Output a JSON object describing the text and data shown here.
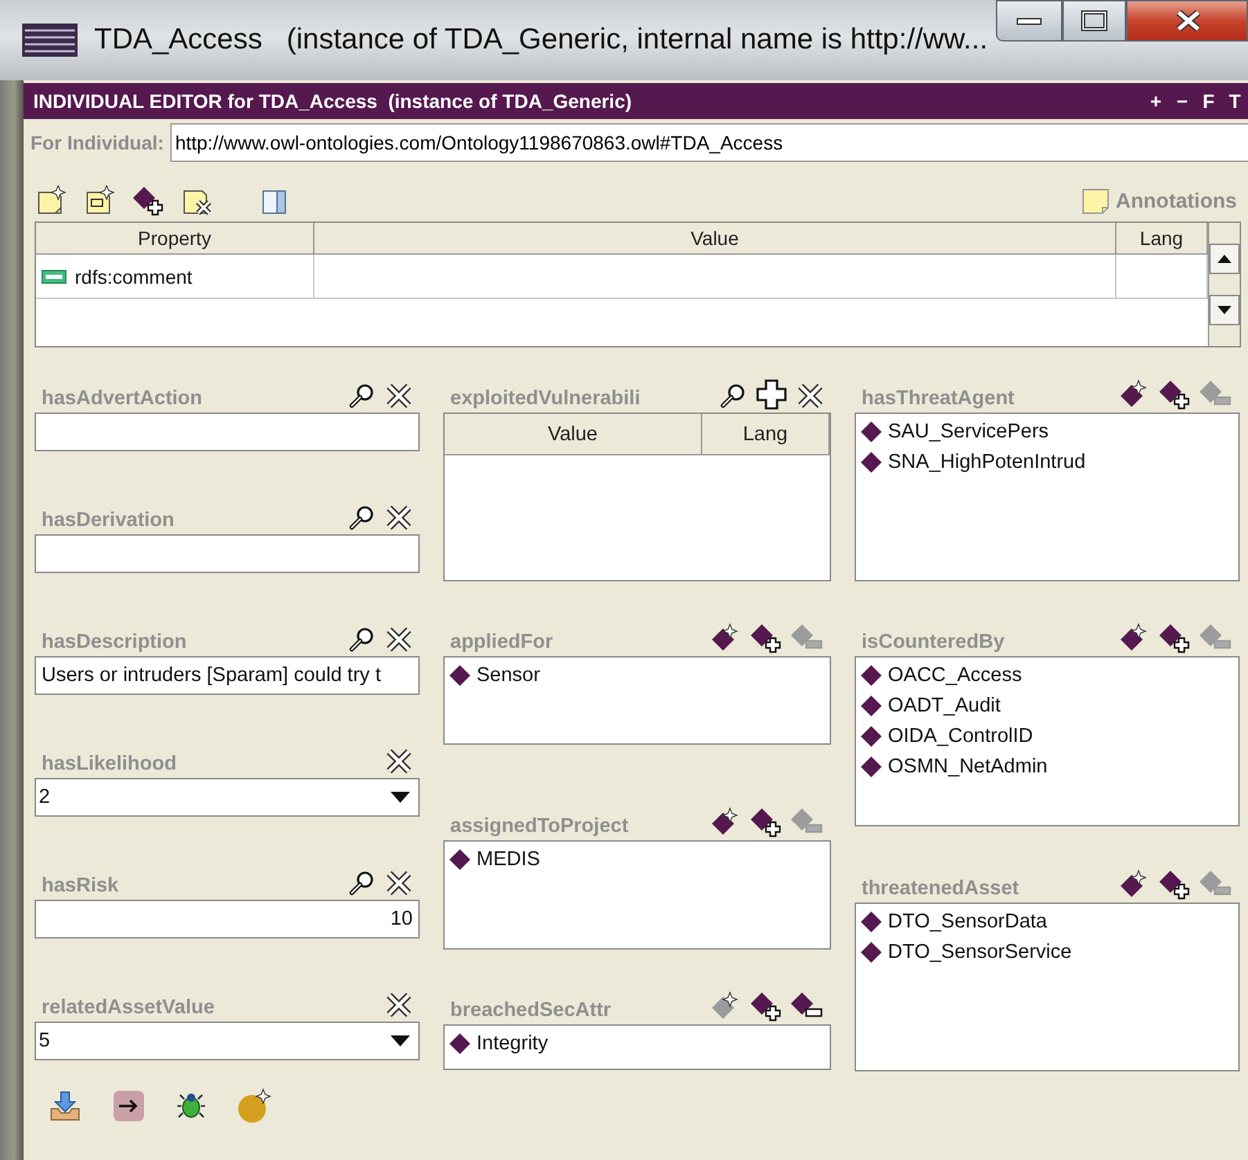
{
  "window": {
    "title": "TDA_Access   (instance of TDA_Generic, internal name is http://ww..."
  },
  "editor": {
    "title": "INDIVIDUAL EDITOR for TDA_Access  (instance of TDA_Generic)",
    "header_buttons": [
      "+",
      "−",
      "F",
      "T"
    ]
  },
  "individual": {
    "label": "For Individual:",
    "value": "http://www.owl-ontologies.com/Ontology1198670863.owl#TDA_Access"
  },
  "toolbar": {
    "buttons": [
      {
        "kind": "create-note"
      },
      {
        "kind": "create-doc-note"
      },
      {
        "kind": "add-instance"
      },
      {
        "kind": "delete-note"
      },
      {
        "kind": "panel"
      }
    ],
    "annotations": "Annotations"
  },
  "annotations_table": {
    "columns": [
      "Property",
      "Value",
      "Lang"
    ],
    "rows": [
      {
        "property": "rdfs:comment"
      }
    ]
  },
  "columns": [
    [
      {
        "kind": "text",
        "label": "hasAdvertAction",
        "buttons": [
          {
            "kind": "find",
            "disabled": false
          },
          {
            "kind": "delete",
            "disabled": false
          }
        ]
      },
      {
        "kind": "text",
        "label": "hasDerivation",
        "buttons": [
          {
            "kind": "find",
            "disabled": false
          },
          {
            "kind": "delete",
            "disabled": false
          }
        ]
      },
      {
        "kind": "text",
        "label": "hasDescription",
        "value": "Users or intruders [Sparam] could try t",
        "buttons": [
          {
            "kind": "find",
            "disabled": false
          },
          {
            "kind": "delete",
            "disabled": false
          }
        ]
      },
      {
        "kind": "combo",
        "label": "hasLikelihood",
        "value": "2",
        "buttons": [
          {
            "kind": "delete",
            "disabled": false
          }
        ]
      },
      {
        "kind": "text",
        "label": "hasRisk",
        "value": "10",
        "numeric": true,
        "buttons": [
          {
            "kind": "find",
            "disabled": false
          },
          {
            "kind": "delete",
            "disabled": false
          }
        ]
      },
      {
        "kind": "combo",
        "label": "relatedAssetValue",
        "value": "5",
        "buttons": [
          {
            "kind": "delete",
            "disabled": false
          }
        ]
      }
    ],
    [
      {
        "kind": "table",
        "label": "exploitedVulnerabili",
        "columns": [
          "Value",
          "Lang"
        ],
        "buttons": [
          {
            "kind": "find",
            "disabled": false
          },
          {
            "kind": "add",
            "disabled": false
          },
          {
            "kind": "delete",
            "disabled": false
          }
        ]
      },
      {
        "kind": "list",
        "label": "appliedFor",
        "items": [
          "Sensor"
        ],
        "buttons": [
          {
            "kind": "create",
            "disabled": false
          },
          {
            "kind": "add-instance",
            "disabled": false
          },
          {
            "kind": "remove-instance",
            "disabled": true
          }
        ]
      },
      {
        "kind": "list",
        "label": "assignedToProject",
        "items": [
          "MEDIS"
        ],
        "buttons": [
          {
            "kind": "create",
            "disabled": false
          },
          {
            "kind": "add-instance",
            "disabled": false
          },
          {
            "kind": "remove-instance",
            "disabled": true
          }
        ]
      },
      {
        "kind": "list",
        "label": "breachedSecAttr",
        "items": [
          "Integrity"
        ],
        "buttons": [
          {
            "kind": "create",
            "disabled": true
          },
          {
            "kind": "add-instance",
            "disabled": false
          },
          {
            "kind": "remove-instance",
            "disabled": false
          }
        ]
      }
    ],
    [
      {
        "kind": "list",
        "label": "hasThreatAgent",
        "items": [
          "SAU_ServicePers",
          "SNA_HighPotenIntrud"
        ],
        "buttons": [
          {
            "kind": "create",
            "disabled": false
          },
          {
            "kind": "add-instance",
            "disabled": false
          },
          {
            "kind": "remove-instance",
            "disabled": true
          }
        ]
      },
      {
        "kind": "list",
        "label": "isCounteredBy",
        "items": [
          "OACC_Access",
          "OADT_Audit",
          "OIDA_ControlID",
          "OSMN_NetAdmin"
        ],
        "buttons": [
          {
            "kind": "create",
            "disabled": false
          },
          {
            "kind": "add-instance",
            "disabled": false
          },
          {
            "kind": "remove-instance",
            "disabled": true
          }
        ]
      },
      {
        "kind": "list",
        "label": "threatenedAsset",
        "items": [
          "DTO_SensorData",
          "DTO_SensorService"
        ],
        "buttons": [
          {
            "kind": "create",
            "disabled": false
          },
          {
            "kind": "add-instance",
            "disabled": false
          },
          {
            "kind": "remove-instance",
            "disabled": true
          }
        ]
      }
    ]
  ],
  "bottom_toolbar": {
    "buttons": [
      {
        "kind": "save"
      },
      {
        "kind": "reference"
      },
      {
        "kind": "bug"
      },
      {
        "kind": "create-instance"
      }
    ]
  }
}
